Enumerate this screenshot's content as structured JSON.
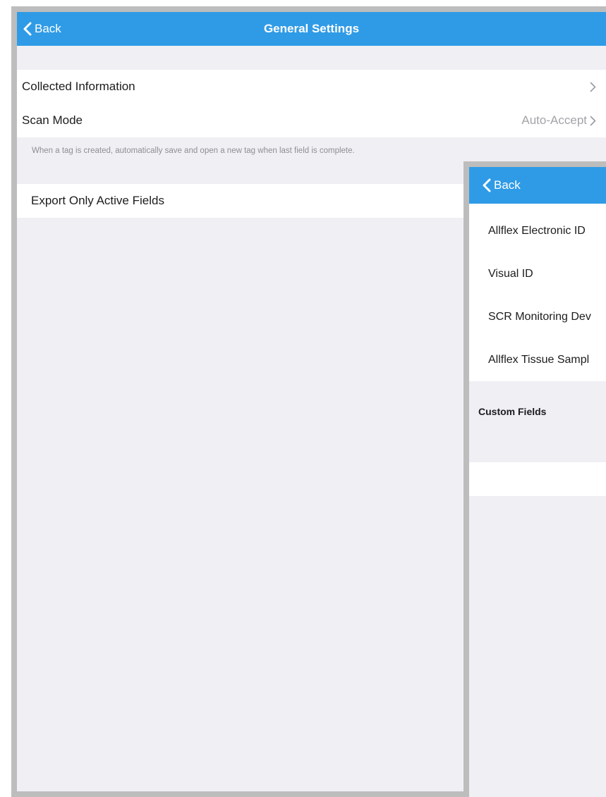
{
  "general_settings": {
    "back_label": "Back",
    "title": "General Settings",
    "rows": {
      "collected_information": "Collected Information",
      "scan_mode": "Scan Mode",
      "scan_mode_value": "Auto-Accept",
      "export_only_active": "Export Only Active Fields"
    },
    "scan_mode_footnote": "When a tag is created, automatically save and open a new tag when last field is complete."
  },
  "collected_information": {
    "back_label": "Back",
    "fields": [
      "Allflex Electronic ID",
      "Visual ID",
      "SCR Monitoring Dev",
      "Allflex Tissue Sampl"
    ],
    "custom_fields_header": "Custom Fields"
  },
  "colors": {
    "nav_blue": "#2f9be6",
    "grouped_background": "#efeff4",
    "secondary_text": "#a3a3a8"
  },
  "icons": [
    "chevron-left-icon",
    "chevron-right-icon"
  ]
}
